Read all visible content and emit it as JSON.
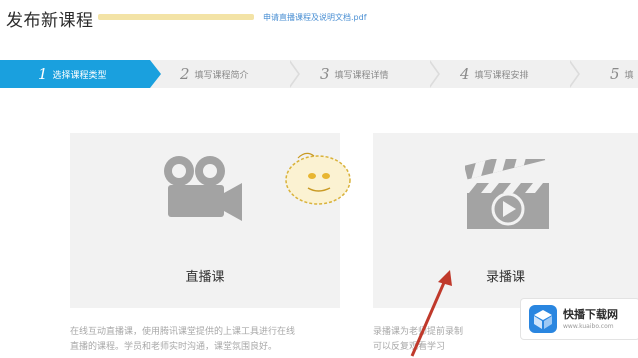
{
  "header": {
    "title": "发布新课程",
    "doc_link": "申请直播课程及说明文档.pdf"
  },
  "steps": [
    {
      "num": "1",
      "label": "选择课程类型",
      "active": true
    },
    {
      "num": "2",
      "label": "填写课程简介",
      "active": false
    },
    {
      "num": "3",
      "label": "填写课程详情",
      "active": false
    },
    {
      "num": "4",
      "label": "填写课程安排",
      "active": false
    },
    {
      "num": "5",
      "label": "填",
      "active": false
    }
  ],
  "cards": {
    "live": {
      "label": "直播课",
      "icon": "video-camera-icon",
      "desc_line1": "在线互动直播课，使用腾讯课堂提供的上课工具进行在线",
      "desc_line2": "直播的课程。学员和老师实时沟通，课堂氛围良好。"
    },
    "recorded": {
      "label": "录播课",
      "icon": "clapperboard-play-icon",
      "desc_line1": "录播课为老师提前录制",
      "desc_line2": "可以反复观看学习"
    }
  },
  "watermark": {
    "name": "快播下载网",
    "url": "www.kuaibo.com"
  },
  "colors": {
    "accent": "#1aa0de",
    "step_inactive": "#f0f0f0",
    "card_bg": "#f2f2f2",
    "icon_gray": "#a3a3a3",
    "annotation_arrow": "#c0392b"
  }
}
